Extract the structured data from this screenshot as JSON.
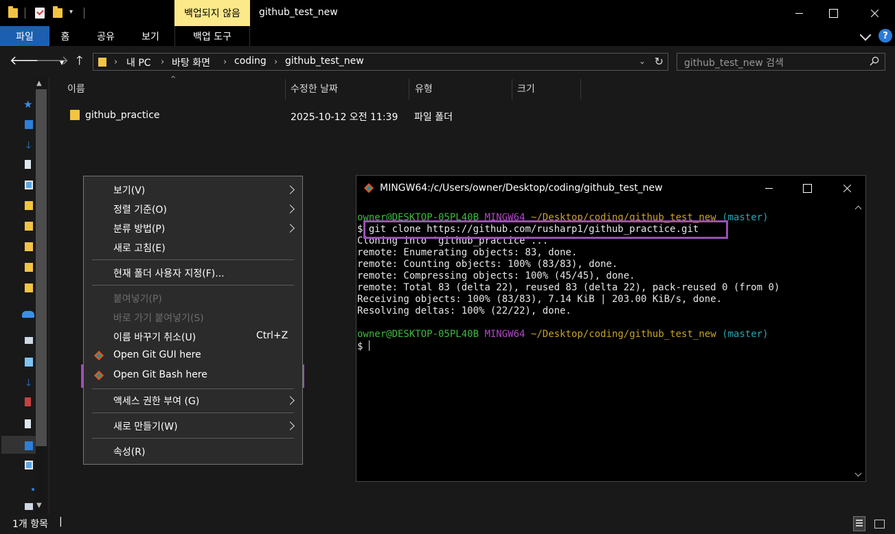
{
  "titlebar": {
    "backup_badge": "백업되지 않음",
    "window_title": "github_test_new",
    "dropdown_glyph": "▾"
  },
  "ribbon": {
    "tabs": [
      "파일",
      "홈",
      "공유",
      "보기"
    ],
    "context_tool": "백업 도구",
    "help": "?"
  },
  "address": {
    "crumbs": [
      "내 PC",
      "바탕 화면",
      "coding",
      "github_test_new"
    ],
    "search_placeholder": "github_test_new 검색"
  },
  "columns": {
    "name": "이름",
    "modified": "수정한 날짜",
    "type": "유형",
    "size": "크기"
  },
  "files": [
    {
      "name": "github_practice",
      "modified": "2025-10-12 오전 11:39",
      "type": "파일 폴더",
      "size": ""
    }
  ],
  "context_menu": {
    "items": [
      {
        "label": "보기(V)",
        "submenu": true
      },
      {
        "label": "정렬 기준(O)",
        "submenu": true
      },
      {
        "label": "분류 방법(P)",
        "submenu": true
      },
      {
        "label": "새로 고침(E)"
      },
      {
        "label": "현재 폴더 사용자 지정(F)..."
      },
      {
        "label": "붙여넣기(P)",
        "disabled": true
      },
      {
        "label": "바로 가기 붙여넣기(S)",
        "disabled": true
      },
      {
        "label": "이름 바꾸기 취소(U)",
        "shortcut": "Ctrl+Z"
      },
      {
        "label": "Open Git GUI here"
      },
      {
        "label": "Open Git Bash here",
        "highlighted": true
      },
      {
        "label": "액세스 권한 부여 (G)",
        "submenu": true
      },
      {
        "label": "새로 만들기(W)",
        "submenu": true
      },
      {
        "label": "속성(R)"
      }
    ]
  },
  "terminal": {
    "title": "MINGW64:/c/Users/owner/Desktop/coding/github_test_new",
    "prompt": {
      "user_host": "owner@DESKTOP-05PL40B",
      "shell": "MINGW64",
      "path": "~/Desktop/coding/github_test_new",
      "branch": "(master)",
      "dollar": "$"
    },
    "command": "git clone https://github.com/rusharp1/github_practice.git",
    "output": [
      "Cloning into 'github_practice'...",
      "remote: Enumerating objects: 83, done.",
      "remote: Counting objects: 100% (83/83), done.",
      "remote: Compressing objects: 100% (45/45), done.",
      "remote: Total 83 (delta 22), reused 83 (delta 22), pack-reused 0 (from 0)",
      "Receiving objects: 100% (83/83), 7.14 KiB | 203.00 KiB/s, done.",
      "Resolving deltas: 100% (22/22), done."
    ]
  },
  "status": {
    "items_count": "1개 항목",
    "caret": "|"
  },
  "colors": {
    "accent": "#1c5fb0",
    "highlight": "#9b4fb4",
    "folder": "#f3c443",
    "badge": "#fbe98a"
  }
}
